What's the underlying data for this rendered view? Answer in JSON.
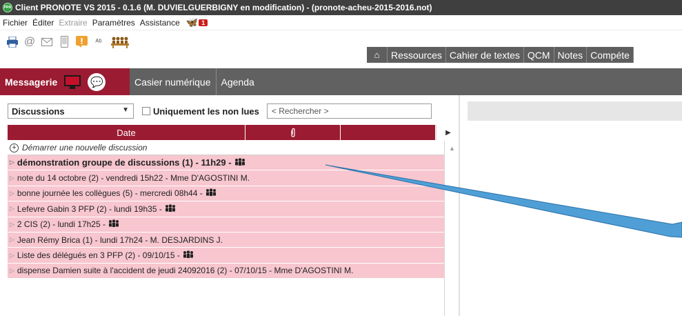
{
  "window": {
    "title": "Client PRONOTE VS 2015 - 0.1.6 (M. DUVIELGUERBIGNY en modification) - (pronote-acheu-2015-2016.not)",
    "logo_text": "PRN"
  },
  "menu": {
    "items": [
      {
        "label": "Fichier",
        "enabled": true
      },
      {
        "label": "Éditer",
        "enabled": true
      },
      {
        "label": "Extraire",
        "enabled": false
      },
      {
        "label": "Paramètres",
        "enabled": true
      },
      {
        "label": "Assistance",
        "enabled": true
      }
    ],
    "notification_count": "1"
  },
  "toolbar": {
    "icons": [
      "print-icon",
      "email-at-icon",
      "envelope-icon",
      "mobile-icon",
      "alert-icon",
      "spellcheck-icon",
      "group-meeting-icon"
    ]
  },
  "nav": {
    "tabs": [
      "Ressources",
      "Cahier de textes",
      "QCM",
      "Notes",
      "Compéte"
    ]
  },
  "sections": {
    "active": "Messagerie",
    "tabs": [
      "Casier numérique",
      "Agenda"
    ]
  },
  "filter": {
    "combo_value": "Discussions",
    "unread_only_label": "Uniquement les non lues",
    "unread_only_checked": false,
    "search_placeholder": "< Rechercher >"
  },
  "list": {
    "header": {
      "date": "Date"
    },
    "start_label": "Démarrer une nouvelle discussion",
    "rows": [
      {
        "text": "démonstration groupe de discussions (1) - 11h29 - ",
        "group": true,
        "bold": true
      },
      {
        "text": "note du 14 octobre (2) - vendredi 15h22 - Mme D'AGOSTINI M.",
        "group": false,
        "bold": false
      },
      {
        "text": "bonne journée les collègues (5) - mercredi 08h44 - ",
        "group": true,
        "bold": false
      },
      {
        "text": "Lefevre Gabin 3 PFP (2) - lundi 19h35 - ",
        "group": true,
        "bold": false
      },
      {
        "text": "2 CIS (2) - lundi 17h25 - ",
        "group": true,
        "bold": false
      },
      {
        "text": "Jean Rémy Brica (1) - lundi 17h24 - M. DESJARDINS J.",
        "group": false,
        "bold": false
      },
      {
        "text": "Liste des délégués en 3 PFP (2) - 09/10/15 - ",
        "group": true,
        "bold": false
      },
      {
        "text": "dispense Damien suite à l'accident de jeudi 24092016 (2) - 07/10/15 - Mme D'AGOSTINI M.",
        "group": false,
        "bold": false
      }
    ]
  },
  "colors": {
    "accent": "#9b1b32",
    "row_pink": "#f7c6cf",
    "tab_gray": "#616161",
    "callout_blue": "#4f9fd6"
  }
}
